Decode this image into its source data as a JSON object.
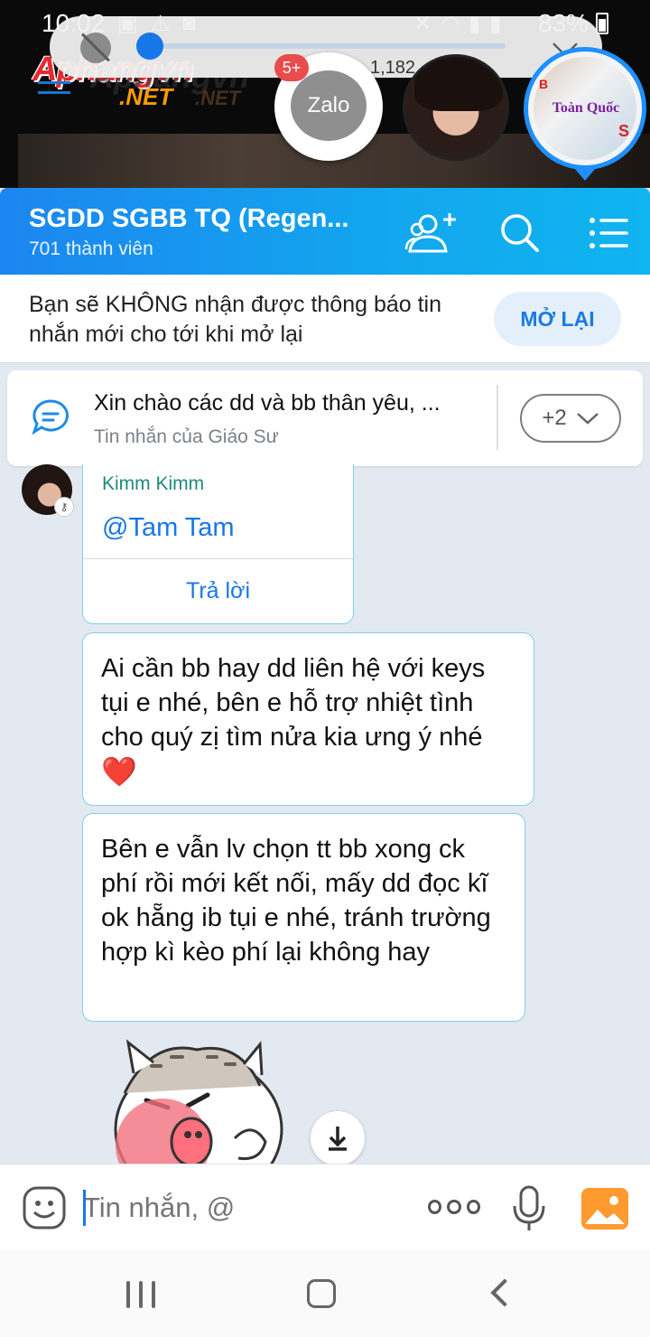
{
  "status_bar": {
    "time": "10:02",
    "battery": "83%"
  },
  "watermark": {
    "brand": "Aphangvn",
    "suffix": ".NET",
    "ghost": "Aphangvn",
    "ghost_suffix": ".NET"
  },
  "chat_heads": {
    "zalo_label": "Zalo",
    "unread_badge": "5+",
    "ghost_count": "1,182",
    "group_avatar_text": "Toàn Quốc",
    "group_avatar_s": "S",
    "group_avatar_b": "B"
  },
  "header": {
    "title": "SGDD SGBB TQ (Regen...",
    "members": "701 thành viên"
  },
  "mute_notice": {
    "message": "Bạn sẽ KHÔNG nhận được thông báo tin nhắn mới cho tới khi mở lại",
    "button": "MỞ LẠI"
  },
  "pinned": {
    "text": "Xin chào các dd và bb thân yêu, ...",
    "sender": "Tin nhắn của Giáo Sư",
    "more_count": "+2"
  },
  "messages": {
    "reply_card": {
      "sender": "Kimm Kimm",
      "mention": "@Tam Tam",
      "reply_button": "Trả lời"
    },
    "msg1": "Ai cần bb hay dd liên hệ với keys tụi e nhé,  bên e hỗ trợ nhiệt tình cho quý zị tìm nửa kia ưng ý nhé",
    "msg1_emoji": "❤️",
    "msg2": "Bên e vẫn lv chọn tt bb xong ck phí rồi mới kết nối,  mấy dd đọc kĩ ok hẵng ib tụi e nhé,  tránh trường hợp kì kèo phí lại không hay"
  },
  "input_bar": {
    "placeholder": "Tin nhắn, @"
  },
  "colors": {
    "header_start": "#1c86f0",
    "header_end": "#10b4ef",
    "accent": "#1877e8",
    "bubble_border": "#7fd0ea",
    "chat_bg": "#e3e9f1"
  }
}
